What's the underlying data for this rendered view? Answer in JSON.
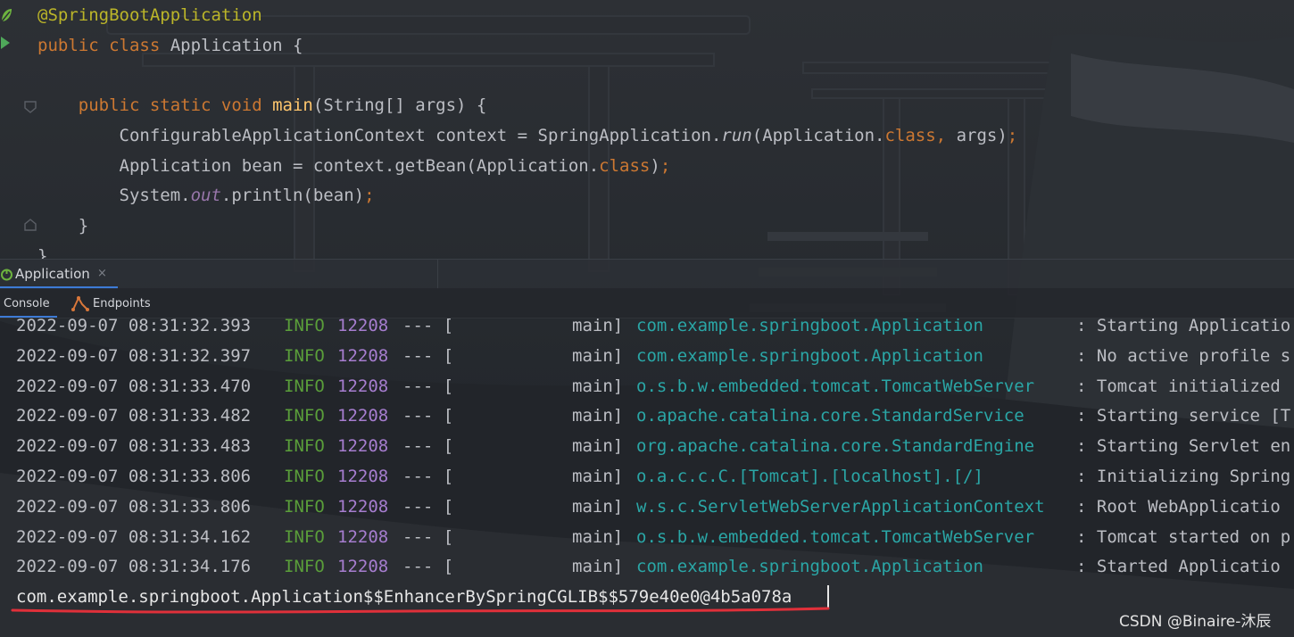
{
  "editor": {
    "lines": [
      {
        "parts": [
          {
            "text": "@SpringBootApplication",
            "cls": "ann"
          }
        ]
      },
      {
        "parts": [
          {
            "text": "public class ",
            "cls": "k"
          },
          {
            "text": "Application {",
            "cls": "pl"
          }
        ]
      },
      {
        "parts": []
      },
      {
        "parts": [
          {
            "text": "    public static void ",
            "cls": "k"
          },
          {
            "text": "main",
            "cls": "fn"
          },
          {
            "text": "(String[] args) {",
            "cls": "pl"
          }
        ]
      },
      {
        "parts": [
          {
            "text": "        ConfigurableApplicationContext context = SpringApplication.",
            "cls": "pl"
          },
          {
            "text": "run",
            "cls": "it2"
          },
          {
            "text": "(Application.",
            "cls": "pl"
          },
          {
            "text": "class",
            "cls": "k"
          },
          {
            "text": ", ",
            "cls": "k"
          },
          {
            "text": "args)",
            "cls": "pl"
          },
          {
            "text": ";",
            "cls": "k"
          }
        ]
      },
      {
        "parts": [
          {
            "text": "        Application bean = context.getBean(Application.",
            "cls": "pl"
          },
          {
            "text": "class",
            "cls": "k"
          },
          {
            "text": ")",
            "cls": "pl"
          },
          {
            "text": ";",
            "cls": "k"
          }
        ]
      },
      {
        "parts": [
          {
            "text": "        System.",
            "cls": "pl"
          },
          {
            "text": "out",
            "cls": "it"
          },
          {
            "text": ".println(bean)",
            "cls": "pl"
          },
          {
            "text": ";",
            "cls": "k"
          }
        ]
      },
      {
        "parts": [
          {
            "text": "    }",
            "cls": "pl"
          }
        ]
      },
      {
        "parts": [
          {
            "text": "}",
            "cls": "pl"
          }
        ]
      }
    ]
  },
  "run_window": {
    "tab_label": "Application",
    "close_glyph": "×",
    "console_tab": "Console",
    "endpoints_tab": "Endpoints"
  },
  "console": {
    "log_lines": [
      {
        "ts": "2022-09-07 08:31:32.393",
        "level": "INFO",
        "pid": "12208",
        "sep": "--- [",
        "thread": "main]",
        "logger": "com.example.springboot.Application",
        "msg": ": Starting Applicatio"
      },
      {
        "ts": "2022-09-07 08:31:32.397",
        "level": "INFO",
        "pid": "12208",
        "sep": "--- [",
        "thread": "main]",
        "logger": "com.example.springboot.Application",
        "msg": ": No active profile s"
      },
      {
        "ts": "2022-09-07 08:31:33.470",
        "level": "INFO",
        "pid": "12208",
        "sep": "--- [",
        "thread": "main]",
        "logger": "o.s.b.w.embedded.tomcat.TomcatWebServer",
        "msg": ": Tomcat initialized"
      },
      {
        "ts": "2022-09-07 08:31:33.482",
        "level": "INFO",
        "pid": "12208",
        "sep": "--- [",
        "thread": "main]",
        "logger": "o.apache.catalina.core.StandardService",
        "msg": ": Starting service [T"
      },
      {
        "ts": "2022-09-07 08:31:33.483",
        "level": "INFO",
        "pid": "12208",
        "sep": "--- [",
        "thread": "main]",
        "logger": "org.apache.catalina.core.StandardEngine",
        "msg": ": Starting Servlet en"
      },
      {
        "ts": "2022-09-07 08:31:33.806",
        "level": "INFO",
        "pid": "12208",
        "sep": "--- [",
        "thread": "main]",
        "logger": "o.a.c.c.C.[Tomcat].[localhost].[/]",
        "msg": ": Initializing Spring"
      },
      {
        "ts": "2022-09-07 08:31:33.806",
        "level": "INFO",
        "pid": "12208",
        "sep": "--- [",
        "thread": "main]",
        "logger": "w.s.c.ServletWebServerApplicationContext",
        "msg": ": Root WebApplicatio"
      },
      {
        "ts": "2022-09-07 08:31:34.162",
        "level": "INFO",
        "pid": "12208",
        "sep": "--- [",
        "thread": "main]",
        "logger": "o.s.b.w.embedded.tomcat.TomcatWebServer",
        "msg": ": Tomcat started on p"
      },
      {
        "ts": "2022-09-07 08:31:34.176",
        "level": "INFO",
        "pid": "12208",
        "sep": "--- [",
        "thread": "main]",
        "logger": "com.example.springboot.Application",
        "msg": ": Started Applicatio"
      }
    ],
    "output": "com.example.springboot.Application$$EnhancerBySpringCGLIB$$579e40e0@4b5a078a"
  },
  "watermark": "CSDN @Binaire-沐辰",
  "colors": {
    "keyword": "#cc7832",
    "annotation": "#bbb529",
    "method": "#ffc66d",
    "info": "#5a9e3a",
    "pid": "#a67dcf",
    "logger": "#2aa6a6",
    "underline": "#e0303a",
    "accent": "#3d7bd6"
  },
  "icons": {
    "run_gutter": "run-triangle-icon",
    "spring_gutter": "spring-leaf-icon",
    "tab": "spring-boot-icon",
    "endpoints": "endpoints-icon"
  }
}
